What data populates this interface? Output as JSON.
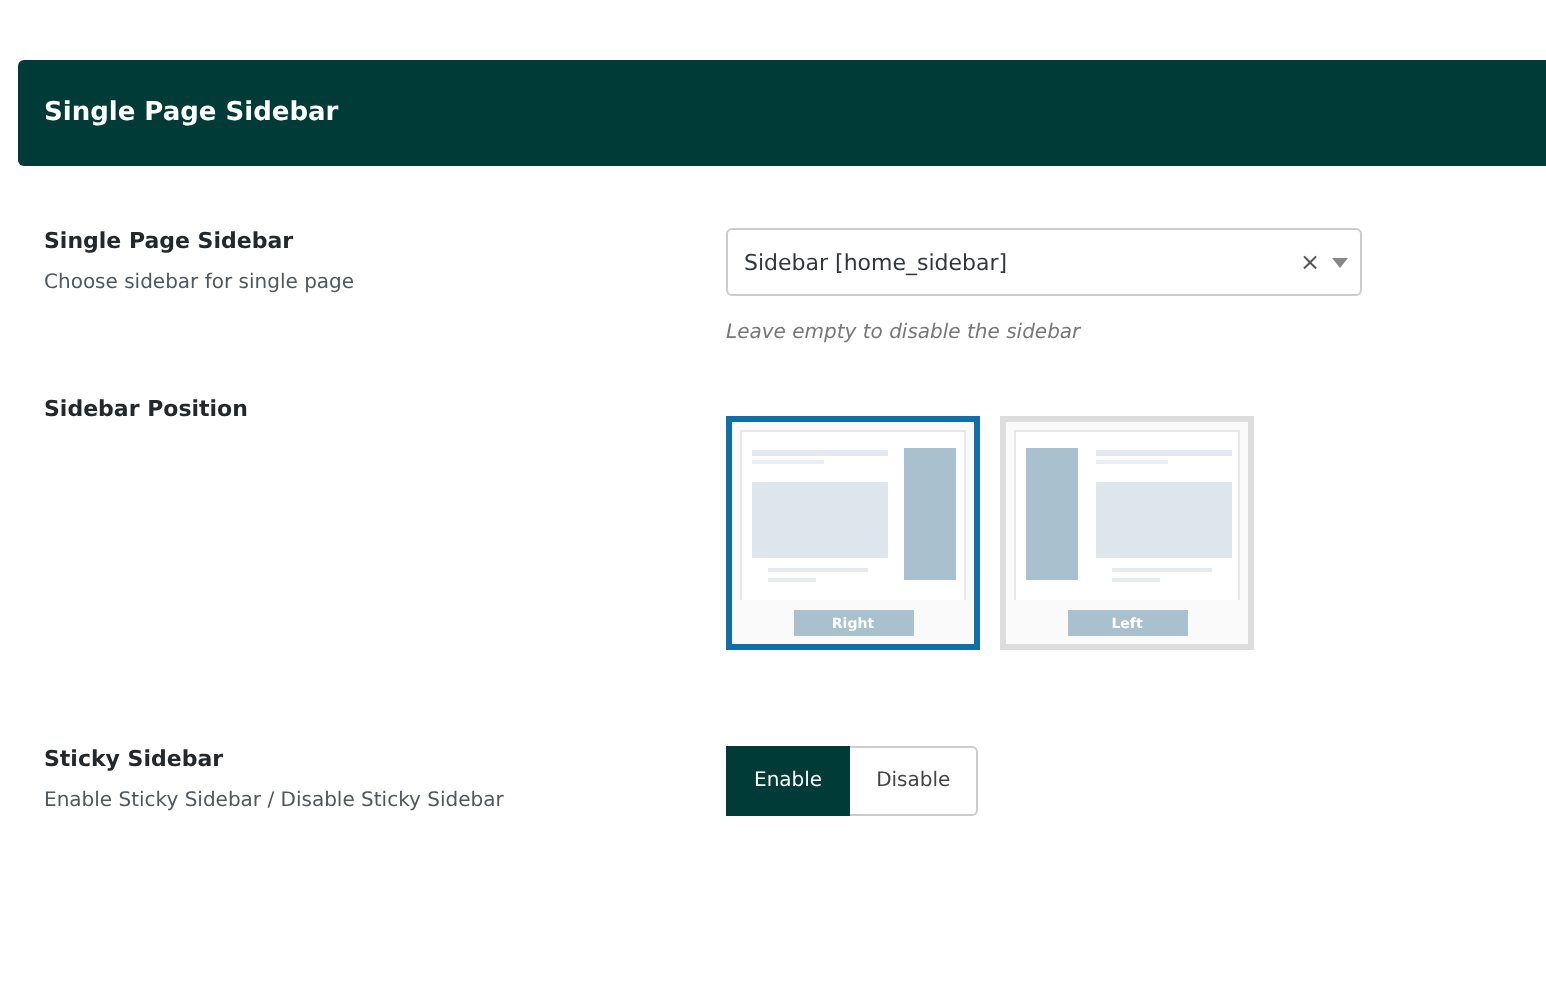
{
  "header": {
    "title": "Single Page Sidebar"
  },
  "sidebar_setting": {
    "label": "Single Page Sidebar",
    "description": "Choose sidebar for single page",
    "value": "Sidebar [home_sidebar]",
    "clear": "×",
    "hint": "Leave empty to disable the sidebar"
  },
  "position_setting": {
    "label": "Sidebar Position",
    "options": [
      {
        "kind": "right",
        "label": "Right",
        "selected": true
      },
      {
        "kind": "left",
        "label": "Left",
        "selected": false
      }
    ]
  },
  "sticky_setting": {
    "label": "Sticky Sidebar",
    "description": "Enable Sticky Sidebar / Disable Sticky Sidebar",
    "buttons": [
      {
        "label": "Enable",
        "selected": true
      },
      {
        "label": "Disable",
        "selected": false
      }
    ]
  }
}
